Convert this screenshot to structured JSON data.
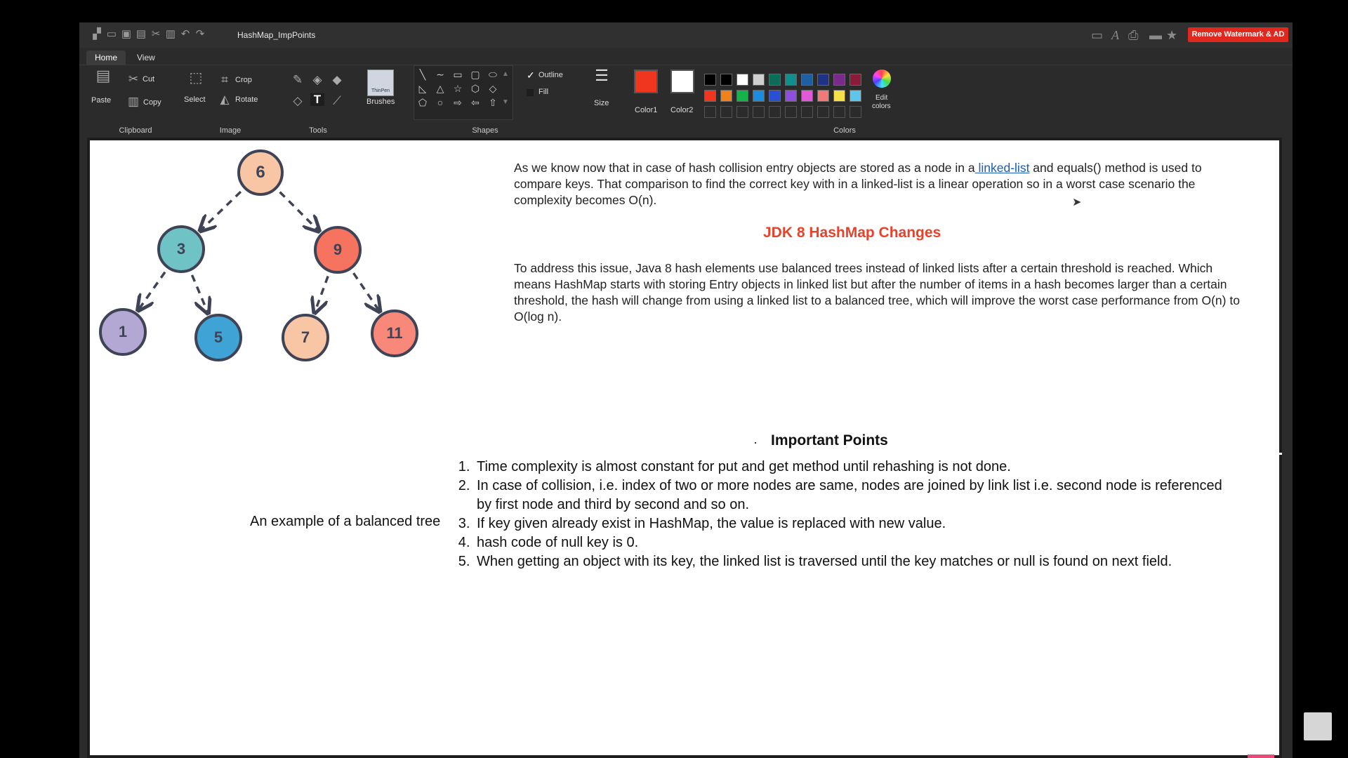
{
  "app": {
    "document_title": "HashMap_ImpPoints",
    "promo_button": "Remove Watermark & AD",
    "tabs": [
      {
        "label": "Home"
      },
      {
        "label": "View"
      }
    ]
  },
  "ribbon": {
    "clipboard": {
      "label": "Clipboard",
      "paste": "Paste",
      "cut": "Cut",
      "copy": "Copy"
    },
    "image": {
      "label": "Image",
      "select": "Select",
      "crop": "Crop",
      "rotate": "Rotate"
    },
    "tools": {
      "label": "Tools"
    },
    "brushes": {
      "label": "Brushes",
      "thumb_text": "ThinPen"
    },
    "shapes": {
      "label": "Shapes",
      "outline": "Outline",
      "fill": "Fill"
    },
    "size": {
      "label": "Size"
    },
    "colors": {
      "label": "Colors",
      "color1_label": "Color1",
      "color2_label": "Color2",
      "edit_label_1": "Edit",
      "edit_label_2": "colors",
      "color1": "#f0361f",
      "color2": "#ffffff",
      "row1": [
        "#000000",
        "#000000",
        "#ffffff",
        "#cfcfcf",
        "#0d6b5a",
        "#118f8f",
        "#1d5fa3",
        "#1f3288",
        "#7a2a8c",
        "#8c1a3a"
      ],
      "row2": [
        "#f0361f",
        "#f0811c",
        "#16b34a",
        "#1a8de0",
        "#2a4fd0",
        "#8e4fe0",
        "#e05ad8",
        "#f07a7a",
        "#f3e04a",
        "#5ec6ea"
      ]
    }
  },
  "canvas": {
    "tree": {
      "nodes": [
        {
          "label": "6",
          "color": "#f9c6a5"
        },
        {
          "label": "3",
          "color": "#6fc3c4"
        },
        {
          "label": "9",
          "color": "#f5735f"
        },
        {
          "label": "1",
          "color": "#b3a8d3"
        },
        {
          "label": "5",
          "color": "#3fa3d6"
        },
        {
          "label": "7",
          "color": "#f9c6a5"
        },
        {
          "label": "11",
          "color": "#f7887a"
        }
      ],
      "caption": "An example of a balanced tree"
    },
    "para1_before": "As we know now that in case of hash collision entry objects are stored as a node in a",
    "para1_link": " linked-list",
    "para1_after": " and equals() method is used to compare keys. That comparison to find the correct key with in a linked-list is a linear operation so in a worst case scenario the complexity becomes O(n).",
    "heading_jdk": "JDK 8 HashMap Changes",
    "para2": "To address this issue, Java 8 hash elements use balanced trees instead of linked lists after a certain threshold is reached. Which means HashMap starts with storing Entry objects in linked list but after the number of items in a hash becomes larger than a certain threshold, the hash will change from using a linked list to a balanced tree, which will improve the worst case performance from O(n) to O(log n).",
    "bullet": "·",
    "heading_points": "Important Points",
    "points": [
      "Time complexity is almost constant for put and get method until rehashing is not done.",
      "In case of collision, i.e. index of two or more nodes are same, nodes are joined by link list i.e. second node is referenced by first node and third by second and so on.",
      "If key given already exist in HashMap, the value is replaced with new value.",
      "hash code of null key is 0.",
      "When getting an object with its key, the linked list is traversed until the key matches or null is found on next field."
    ]
  }
}
